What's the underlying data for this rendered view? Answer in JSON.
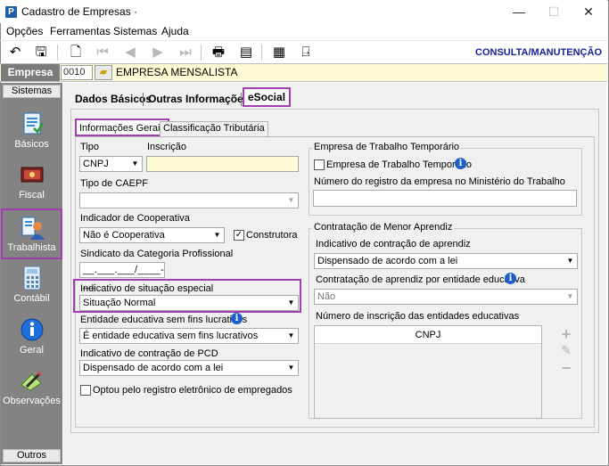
{
  "window": {
    "title": "Cadastro de Empresas ·",
    "app_icon": "P",
    "minimize": "—",
    "maximize": "☐",
    "close": "✕"
  },
  "menu": [
    "Opções",
    "Ferramentas",
    "Sistemas",
    "Ajuda"
  ],
  "toolbar": {
    "icons": [
      "undo-icon",
      "save-icon",
      "preview-icon",
      "first-record-icon",
      "previous-record-icon",
      "next-record-icon",
      "last-record-icon",
      "print-icon",
      "export-icon",
      "report-icon",
      "exit-icon"
    ],
    "mode": "CONSULTA/MANUTENÇÃO"
  },
  "company": {
    "label": "Empresa",
    "code": "0010",
    "name": "EMPRESA MENSALISTA"
  },
  "sidebar": {
    "header": "Sistemas",
    "footer": "Outros",
    "items": [
      {
        "label": "Básicos",
        "icon": "basics-icon"
      },
      {
        "label": "Fiscal",
        "icon": "fiscal-icon"
      },
      {
        "label": "Trabalhista",
        "icon": "labor-icon"
      },
      {
        "label": "Contábil",
        "icon": "calculator-icon"
      },
      {
        "label": "Geral",
        "icon": "info-icon"
      },
      {
        "label": "Observações",
        "icon": "notes-icon"
      }
    ]
  },
  "tabs": [
    "Dados Básicos",
    "Outras Informações",
    "eSocial"
  ],
  "subtabs": [
    "Informações Gerais",
    "Classificação Tributária"
  ],
  "form": {
    "tipo_label": "Tipo",
    "tipo_value": "CNPJ",
    "inscricao_label": "Inscrição",
    "inscricao_value": "",
    "caepf_label": "Tipo de CAEPF",
    "caepf_value": "",
    "cooperativa_label": "Indicador de Cooperativa",
    "cooperativa_value": "Não é Cooperativa",
    "construtora_label": "Construtora",
    "construtora_checked": "✓",
    "sindicato_label": "Sindicato da Categoria Profissional",
    "sindicato_mask": "__.___.___/____-__",
    "situacao_label": "Indicativo de situação especial",
    "situacao_value": "Situação Normal",
    "entidade_label": "Entidade educativa sem fins lucrativos",
    "entidade_value": "É entidade educativa sem fins lucrativos",
    "pcd_label": "Indicativo de contração de PCD",
    "pcd_value": "Dispensado de acordo com a lei",
    "registro_label": "Optou pelo registro eletrônico de empregados"
  },
  "temporario": {
    "title": "Empresa de Trabalho Temporário",
    "checkbox_label": "Empresa de Trabalho Temporário",
    "registro_label": "Número do registro da empresa no Ministério do Trabalho",
    "registro_value": ""
  },
  "aprendiz": {
    "title": "Contratação de Menor Aprendiz",
    "indicativo_label": "Indicativo de contração de aprendiz",
    "indicativo_value": "Dispensado de acordo com a lei",
    "entidade_label": "Contratação de aprendiz por entidade educativa",
    "entidade_value": "Não",
    "inscricao_label": "Número de inscrição das entidades educativas",
    "grid_header": "CNPJ"
  },
  "colors": {
    "highlight": "#a13fb0",
    "accent": "#17219a",
    "sidebar": "#838383",
    "yellow": "#fffbd4"
  }
}
